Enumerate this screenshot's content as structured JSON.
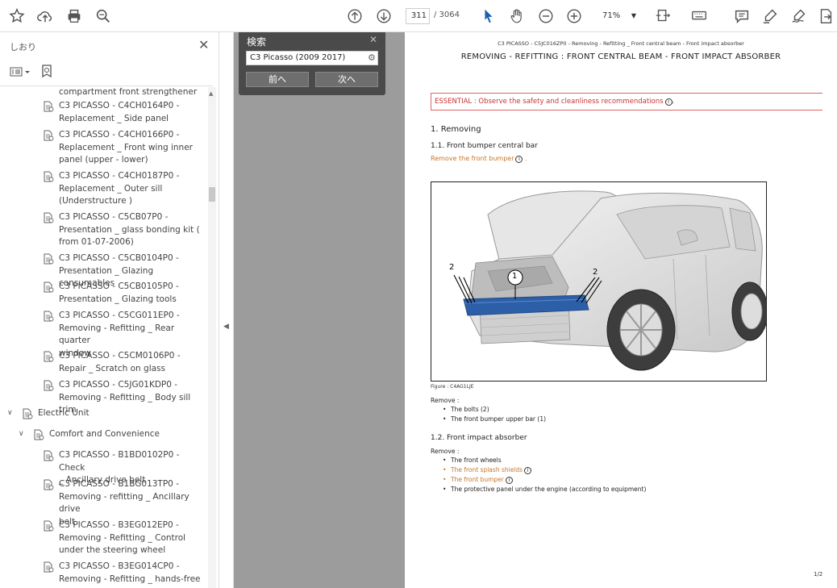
{
  "toolbar": {
    "page_current": "311",
    "page_total": "/ 3064",
    "zoom": "71%",
    "icons": [
      "star-icon",
      "upload-cloud-icon",
      "print-icon",
      "zoom-search-icon",
      "page-up-icon",
      "page-down-icon",
      "cursor-icon",
      "hand-icon",
      "zoom-out-icon",
      "zoom-in-icon",
      "fit-page-icon",
      "keyboard-icon",
      "comment-icon",
      "highlight-pen-icon",
      "sign-icon",
      "export-icon"
    ]
  },
  "sidebar": {
    "title": "しおり",
    "items": [
      {
        "text": "compartment front strengthener"
      },
      {
        "text": "C3 PICASSO - C4CH0164P0 -",
        "line2": "Replacement _ Side panel"
      },
      {
        "text": "C3 PICASSO - C4CH0166P0 -",
        "line2": "Replacement _ Front wing inner",
        "line3": "panel (upper - lower)"
      },
      {
        "text": "C3 PICASSO - C4CH0187P0 -",
        "line2": "Replacement _ Outer sill",
        "line3": "(Understructure )"
      },
      {
        "text": "C3 PICASSO - C5CB07P0 -",
        "line2": "Presentation _ glass bonding kit (",
        "line3": "from 01-07-2006)"
      },
      {
        "text": "C3 PICASSO - C5CB0104P0 -",
        "line2": "Presentation _ Glazing consumables"
      },
      {
        "text": "C3 PICASSO - C5CB0105P0 -",
        "line2": "Presentation _ Glazing tools"
      },
      {
        "text": "C3 PICASSO - C5CG011EP0 -",
        "line2": "Removing - Refitting _ Rear quarter",
        "line3": "window"
      },
      {
        "text": "C3 PICASSO - C5CM0106P0 -",
        "line2": "Repair _ Scratch on glass"
      },
      {
        "text": "C3 PICASSO - C5JG01KDP0 -",
        "line2": "Removing - Refitting _ Body sill trim"
      },
      {
        "text": "Electric Unit"
      },
      {
        "text": "Comfort and Convenience"
      },
      {
        "text": "C3 PICASSO - B1BD0102P0 - Check",
        "line2": "_ Ancillary drive belt"
      },
      {
        "text": "C3 PICASSO - B1BG013TP0 -",
        "line2": "Removing - refitting _ Ancillary drive",
        "line3": "belt"
      },
      {
        "text": "C3 PICASSO - B3EG012EP0 -",
        "line2": "Removing - Refitting _ Control",
        "line3": "under the steering wheel"
      },
      {
        "text": "C3 PICASSO - B3EG014CP0 -",
        "line2": "Removing - Refitting _ hands-free"
      }
    ]
  },
  "search": {
    "title": "検索",
    "query": "C3 Picasso (2009 2017)",
    "prev_label": "前へ",
    "next_label": "次へ"
  },
  "doc": {
    "header": "C3 PICASSO - C5JC016ZP0 - Removing - Refitting _ Front central beam - Front impact absorber",
    "title": "REMOVING - REFITTING : FRONT CENTRAL BEAM - FRONT IMPACT ABSORBER",
    "essential": "ESSENTIAL : Observe the safety and cleanliness recommendations",
    "h_removing": "1. Removing",
    "h_1_1": "1.1. Front bumper central bar",
    "link_remove_bumper": "Remove the front bumper",
    "figure_caption": "Figure : C4AG1LJE",
    "callout_1": "1",
    "callout_2a": "2",
    "callout_2b": "2",
    "remove_label": "Remove :",
    "list_1": [
      "The bolts (2)",
      "The front bumper upper bar (1)"
    ],
    "h_1_2": "1.2. Front impact absorber",
    "remove_label_2": "Remove :",
    "list_2": [
      {
        "text": "The front wheels",
        "link": false,
        "info": false
      },
      {
        "text": "The front splash shields",
        "link": true,
        "info": true
      },
      {
        "text": "The front bumper",
        "link": true,
        "info": true
      },
      {
        "text": "The protective panel under the engine (according to equipment)",
        "link": false,
        "info": false
      }
    ],
    "page_num": "1/2"
  }
}
